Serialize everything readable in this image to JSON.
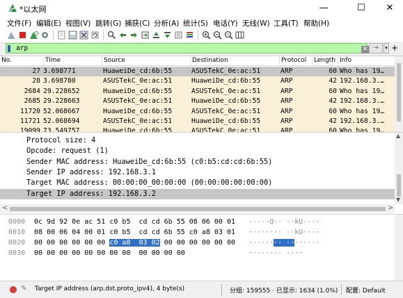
{
  "window": {
    "title": "*以太网",
    "minimize": "—",
    "maximize": "☐",
    "close": "✕"
  },
  "menu": [
    "文件(F)",
    "编辑(E)",
    "视图(V)",
    "跳转(G)",
    "捕获(C)",
    "分析(A)",
    "统计(S)",
    "电话(Y)",
    "无线(W)",
    "工具(T)",
    "帮助(H)"
  ],
  "toolbar": {
    "icons": [
      "shark-fin-start-icon",
      "stop-icon",
      "restart-icon",
      "options-gear-icon",
      "open-file-icon",
      "save-file-icon",
      "close-file-icon",
      "reload-icon",
      "find-icon",
      "back-icon",
      "forward-icon",
      "go-to-packet-icon",
      "first-packet-icon",
      "last-packet-icon",
      "autoscroll-icon",
      "colorize-icon",
      "zoom-in-icon",
      "zoom-out-icon",
      "normal-size-icon",
      "resize-columns-icon"
    ]
  },
  "filter": {
    "value": "arp",
    "clear": "✕",
    "apply": "→",
    "dropdown": "▾",
    "add": "+"
  },
  "packet_list": {
    "columns": [
      "No.",
      "Time",
      "Source",
      "Destination",
      "Protocol",
      "Length",
      "Info"
    ],
    "rows": [
      {
        "no": "27",
        "time": "3.698771",
        "src": "HuaweiDe_cd:6b:55",
        "dst": "ASUSTekC_0e:ac:51",
        "proto": "ARP",
        "len": "60",
        "info": "Who has 19…",
        "selected": true
      },
      {
        "no": "28",
        "time": "3.698780",
        "src": "ASUSTekC_0e:ac:51",
        "dst": "HuaweiDe_cd:6b:55",
        "proto": "ARP",
        "len": "42",
        "info": "192.168.3.…",
        "selected": false
      },
      {
        "no": "2684",
        "time": "29.228652",
        "src": "HuaweiDe_cd:6b:55",
        "dst": "ASUSTekC_0e:ac:51",
        "proto": "ARP",
        "len": "60",
        "info": "Who has 19…",
        "selected": false
      },
      {
        "no": "2685",
        "time": "29.228663",
        "src": "ASUSTekC_0e:ac:51",
        "dst": "HuaweiDe_cd:6b:55",
        "proto": "ARP",
        "len": "42",
        "info": "192.168.3.…",
        "selected": false
      },
      {
        "no": "11720",
        "time": "52.068667",
        "src": "HuaweiDe_cd:6b:55",
        "dst": "ASUSTekC_0e:ac:51",
        "proto": "ARP",
        "len": "60",
        "info": "Who has 19…",
        "selected": false
      },
      {
        "no": "11721",
        "time": "52.068694",
        "src": "ASUSTekC_0e:ac:51",
        "dst": "HuaweiDe_cd:6b:55",
        "proto": "ARP",
        "len": "42",
        "info": "192.168.3.…",
        "selected": false
      },
      {
        "no": "19099",
        "time": "73.549757",
        "src": "HuaweiDe_cd:6b:55",
        "dst": "ASUSTekC_0e:ac:51",
        "proto": "ARP",
        "len": "60",
        "info": "Who has 19…",
        "selected": false
      }
    ],
    "row_color": "#faf0d7",
    "selected_color": "#c6c6c6"
  },
  "details": {
    "lines": [
      {
        "text": "Protocol size: 4",
        "selected": false
      },
      {
        "text": "Opcode: request (1)",
        "selected": false
      },
      {
        "text": "Sender MAC address: HuaweiDe_cd:6b:55 (c0:b5:cd:cd:6b:55)",
        "selected": false
      },
      {
        "text": "Sender IP address: 192.168.3.1",
        "selected": false
      },
      {
        "text": "Target MAC address: 00:00:00_00:00:00 (00:00:00:00:00:00)",
        "selected": false
      },
      {
        "text": "Target IP address: 192.168.3.2",
        "selected": true
      }
    ],
    "scroll_left": "<",
    "scroll_right": ">",
    "scroll_up": "▲",
    "scroll_down": "▼"
  },
  "bytes": {
    "lines": [
      {
        "offset": "0000",
        "hex_a": "0c 9d 92 0e ac 51 c0 b5  cd cd 6b 55 08 06 00 01",
        "hex_hl": "",
        "hex_b": "",
        "ascii_a": "·····Q·· ··kU····",
        "ascii_hl": "",
        "ascii_b": ""
      },
      {
        "offset": "0010",
        "hex_a": "08 00 06 04 00 01 c0 b5  cd cd 6b 55 c0 a8 03 01",
        "hex_hl": "",
        "hex_b": "",
        "ascii_a": "········ ··kU····",
        "ascii_hl": "",
        "ascii_b": ""
      },
      {
        "offset": "0020",
        "hex_a": "00 00 00 00 00 00 ",
        "hex_hl": "c0 a8  03 02",
        "hex_b": " 00 00 00 00 00 00",
        "ascii_a": "······",
        "ascii_hl": "·· ··",
        "ascii_b": "······"
      },
      {
        "offset": "0030",
        "hex_a": "00 00 00 00 00 00 00 00  00 00 00 00",
        "hex_hl": "",
        "hex_b": "",
        "ascii_a": "········ ····",
        "ascii_hl": "",
        "ascii_b": ""
      }
    ]
  },
  "status": {
    "field": "Target IP address (arp.dst.proto_ipv4), 4 byte(s)",
    "packets": "分组: 159555 · 已显示: 1634 (1.0%)",
    "profile": "配置: Default"
  },
  "colors": {
    "filter_valid": "#b7f7a8",
    "selection": "#c6c6c6",
    "bytes_highlight": "#3070c8",
    "arp_row": "#faf0d7"
  }
}
